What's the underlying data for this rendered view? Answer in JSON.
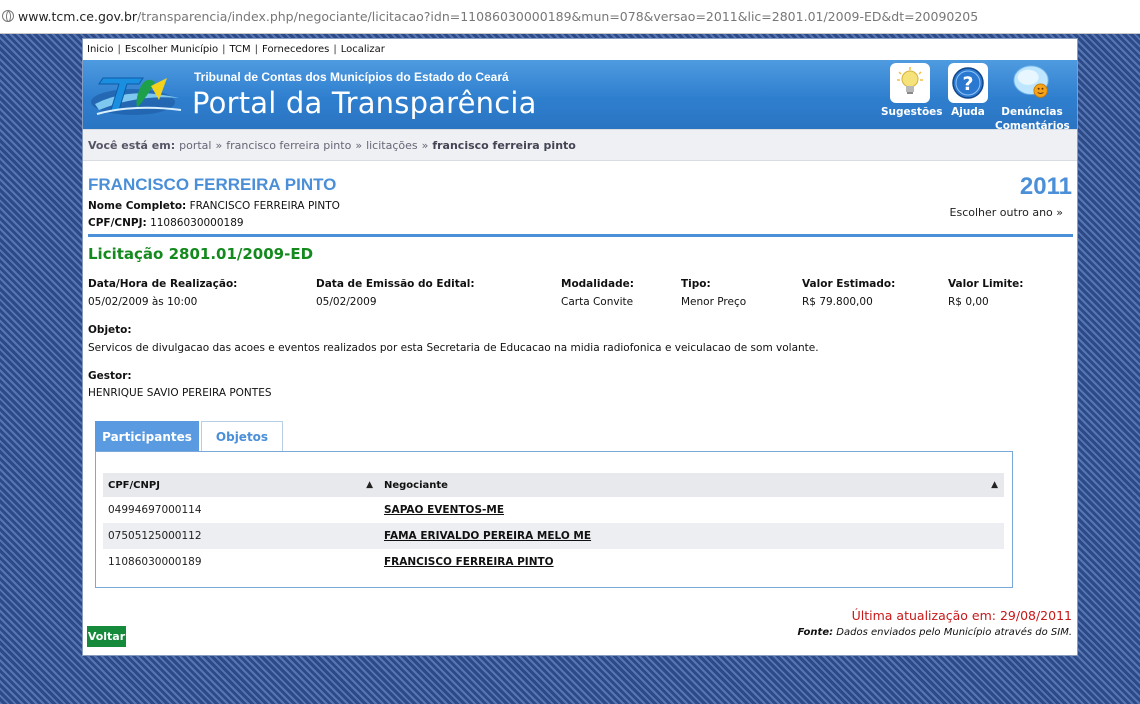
{
  "browser": {
    "url_host": "www.tcm.ce.gov.br",
    "url_path": "/transparencia/index.php/negociante/licitacao?idn=11086030000189&mun=078&versao=2011&lic=2801.01/2009-ED&dt=20090205"
  },
  "topnav": {
    "items": [
      "Inicio",
      "Escolher Município",
      "TCM",
      "Fornecedores",
      "Localizar"
    ],
    "separator": "|"
  },
  "banner": {
    "subtitle": "Tribunal de Contas dos Municípios do Estado do Ceará",
    "title": "Portal da Transparência",
    "icons": [
      {
        "label": "Sugestões",
        "icon": "lightbulb-icon"
      },
      {
        "label": "Ajuda",
        "icon": "help-icon"
      },
      {
        "label_line1": "Denúncias",
        "label_line2": "Comentários",
        "icon": "chat-icon"
      }
    ]
  },
  "breadcrumb": {
    "prefix": "Você está em:",
    "items": [
      "portal",
      "francisco ferreira pinto",
      "licitações"
    ],
    "arrow": "»",
    "current": "francisco ferreira pinto"
  },
  "negociante": {
    "name": "FRANCISCO FERREIRA PINTO",
    "full_name_label": "Nome Completo:",
    "full_name": "FRANCISCO FERREIRA PINTO",
    "doc_label": "CPF/CNPJ:",
    "doc": "11086030000189",
    "year": "2011",
    "other_year": "Escolher outro ano »"
  },
  "licitacao": {
    "title": "Licitação 2801.01/2009-ED",
    "fields": [
      {
        "label": "Data/Hora de Realização:",
        "value": "05/02/2009 às 10:00"
      },
      {
        "label": "Data de Emissão do Edital:",
        "value": "05/02/2009"
      },
      {
        "label": "Modalidade:",
        "value": "Carta Convite"
      },
      {
        "label": "Tipo:",
        "value": "Menor Preço"
      },
      {
        "label": "Valor Estimado:",
        "value": "R$ 79.800,00"
      },
      {
        "label": "Valor Limite:",
        "value": "R$ 0,00"
      }
    ],
    "objeto_label": "Objeto:",
    "objeto": "Servicos de divulgacao das acoes e eventos realizados por esta Secretaria de Educacao na midia radiofonica e veiculacao de som volante.",
    "gestor_label": "Gestor:",
    "gestor": "HENRIQUE SAVIO PEREIRA PONTES"
  },
  "tabs": {
    "participantes": "Participantes",
    "objetos": "Objetos"
  },
  "table": {
    "headers": [
      "CPF/CNPJ",
      "Negociante"
    ],
    "rows": [
      {
        "doc": "04994697000114",
        "name": "SAPAO EVENTOS-ME"
      },
      {
        "doc": "07505125000112",
        "name": "FAMA ERIVALDO PEREIRA MELO ME"
      },
      {
        "doc": "11086030000189",
        "name": "FRANCISCO FERREIRA PINTO"
      }
    ]
  },
  "footer": {
    "last_update": "Última atualização em: 29/08/2011",
    "source_label": "Fonte:",
    "source_text": "Dados enviados pelo Município através do SIM.",
    "back": "Voltar"
  },
  "colors": {
    "banner_blue": "#2f7fcf",
    "title_blue": "#4a8fd8",
    "licitacao_green": "#148a1e",
    "update_red": "#c81818",
    "back_button_green": "#148a3a"
  }
}
